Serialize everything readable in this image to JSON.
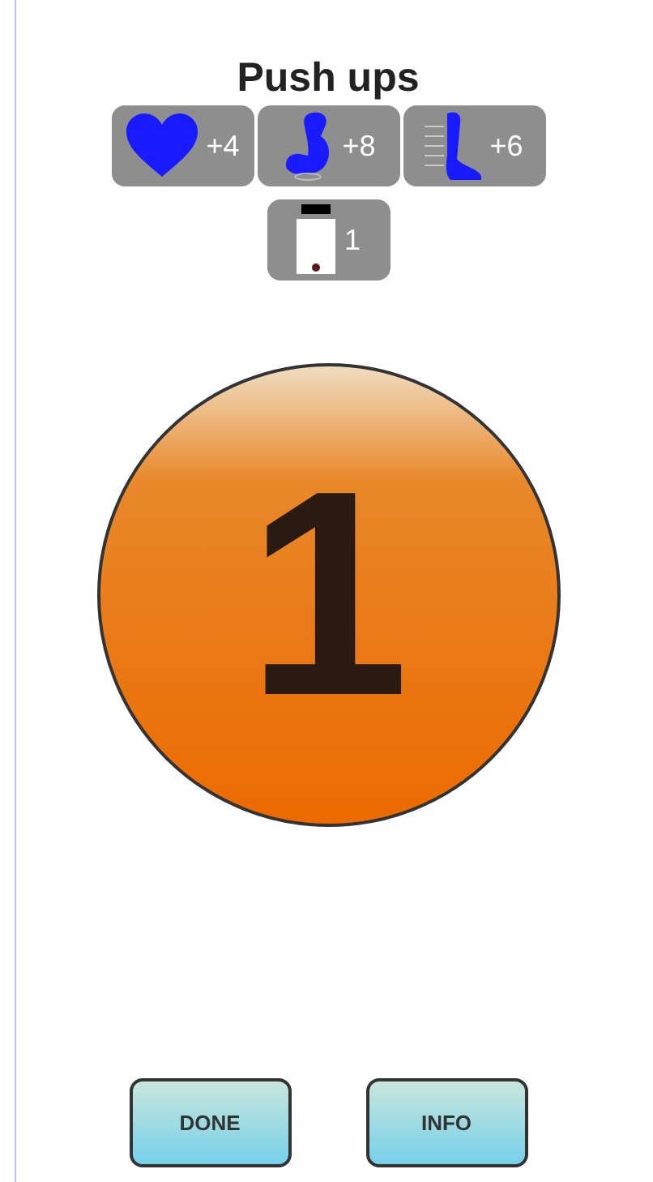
{
  "title": "Push ups",
  "stats": [
    {
      "kind": "heart",
      "value": "+4"
    },
    {
      "kind": "arm",
      "value": "+8"
    },
    {
      "kind": "leg",
      "value": "+6"
    }
  ],
  "device": {
    "kind": "phone",
    "value": "1"
  },
  "counter": "1",
  "buttons": [
    "DONE",
    "INFO"
  ]
}
